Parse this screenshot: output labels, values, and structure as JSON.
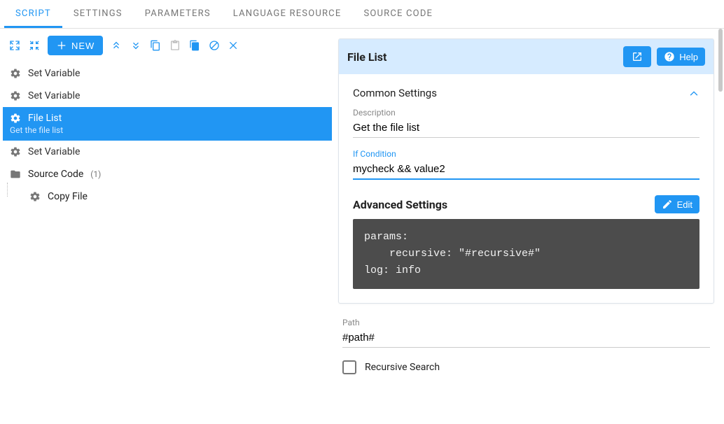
{
  "tabs": {
    "script": "SCRIPT",
    "settings": "SETTINGS",
    "parameters": "PARAMETERS",
    "language_resource": "LANGUAGE RESOURCE",
    "source_code": "SOURCE CODE"
  },
  "toolbar": {
    "new_label": "NEW"
  },
  "tree": {
    "items": [
      {
        "label": "Set Variable"
      },
      {
        "label": "Set Variable"
      },
      {
        "label": "File List",
        "sub": "Get the file list",
        "selected": true
      },
      {
        "label": "Set Variable"
      }
    ],
    "group": {
      "label": "Source Code",
      "count": "(1)"
    },
    "child": {
      "label": "Copy File"
    }
  },
  "panel": {
    "title": "File List",
    "help_label": "Help",
    "common_title": "Common Settings",
    "description_label": "Description",
    "description_value": "Get the file list",
    "if_label": "If Condition",
    "if_value": "mycheck && value2",
    "advanced_title": "Advanced Settings",
    "edit_label": "Edit",
    "code": "params:\n    recursive: \"#recursive#\"\nlog: info"
  },
  "fields": {
    "path_label": "Path",
    "path_value": "#path#",
    "recursive_label": "Recursive Search"
  }
}
